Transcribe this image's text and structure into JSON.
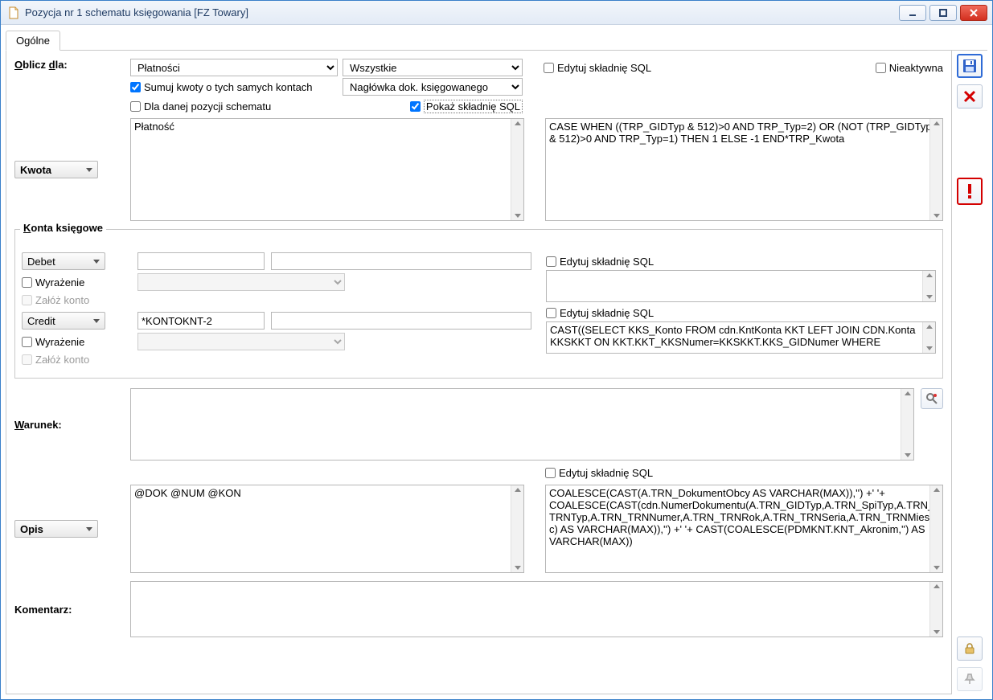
{
  "window": {
    "title": "Pozycja nr 1 schematu księgowania [FZ Towary]"
  },
  "tabs": {
    "general": "Ogólne"
  },
  "labels": {
    "oblicz_dla": "Oblicz dla:",
    "kwota": "Kwota",
    "konta": "Konta księgowe",
    "debet": "Debet",
    "credit": "Credit",
    "warunek": "Warunek:",
    "opis": "Opis",
    "komentarz": "Komentarz:",
    "wyrazenie": "Wyrażenie",
    "zaloz_konto": "Załóż konto",
    "nieaktywna": "Nieaktywna",
    "sumuj": "Sumuj kwoty o tych samych kontach",
    "dla_danej": "Dla danej pozycji schematu",
    "pokaz_sql": "Pokaż składnię SQL",
    "edytuj_sql": "Edytuj składnię SQL"
  },
  "selects": {
    "platnosci": "Płatności",
    "wszystkie": "Wszystkie",
    "naglowka": "Nagłówka dok. księgowanego"
  },
  "checkboxes": {
    "sumuj": true,
    "dla_danej": false,
    "pokaz_sql": true,
    "nieaktywna": false,
    "edytuj_sql_kwota": false,
    "edytuj_sql_debet": false,
    "edytuj_sql_credit": false,
    "edytuj_sql_opis": false,
    "wyrazenie_debet": false,
    "zaloz_debet": false,
    "wyrazenie_credit": false,
    "zaloz_credit": false
  },
  "values": {
    "kwota_left": "Płatność",
    "kwota_right": "CASE WHEN ((TRP_GIDTyp & 512)>0 AND TRP_Typ=2) OR (NOT (TRP_GIDTyp & 512)>0 AND TRP_Typ=1) THEN 1 ELSE -1 END*TRP_Kwota",
    "debet_a": "",
    "debet_b": "",
    "debet_sql": "",
    "credit_a": "*KONTOKNT-2",
    "credit_b": "",
    "credit_sql": "CAST((SELECT KKS_Konto FROM cdn.KntKonta KKT LEFT JOIN CDN.Konta KKSKKT ON KKT.KKT_KKSNumer=KKSKKT.KKS_GIDNumer WHERE",
    "warunek": "",
    "opis_left": "@DOK @NUM @KON",
    "opis_right": "COALESCE(CAST(A.TRN_DokumentObcy AS VARCHAR(MAX)),'') +' '+ COALESCE(CAST(cdn.NumerDokumentu(A.TRN_GIDTyp,A.TRN_SpiTyp,A.TRN_TRNTyp,A.TRN_TRNNumer,A.TRN_TRNRok,A.TRN_TRNSeria,A.TRN_TRNMiesiac) AS VARCHAR(MAX)),'') +' '+ CAST(COALESCE(PDMKNT.KNT_Akronim,'') AS VARCHAR(MAX))",
    "komentarz": ""
  }
}
